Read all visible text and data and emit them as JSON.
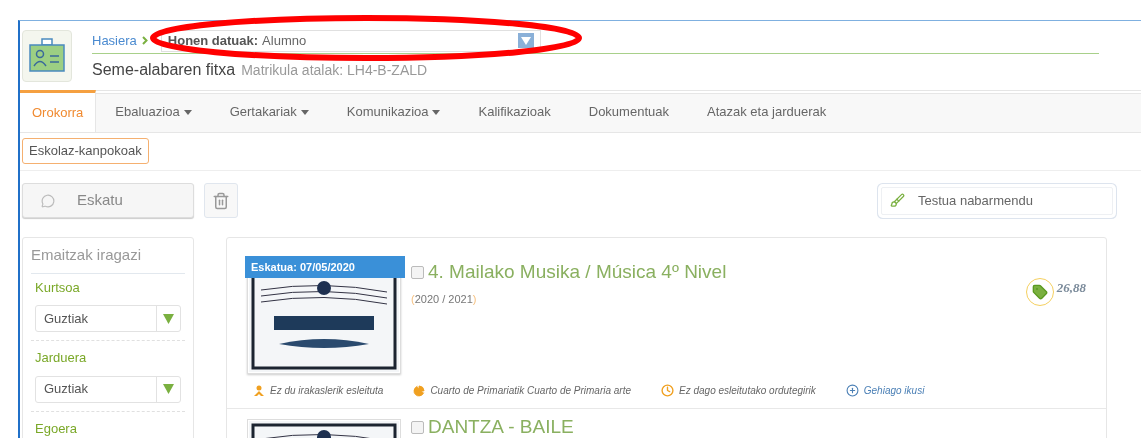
{
  "breadcrumb": {
    "home": "Hasiera",
    "selector_label": "Honen datuak:",
    "selector_value": "Alumno"
  },
  "page_title": "Seme-alabaren fitxa",
  "page_subtitle": "Matrikula atalak: LH4-B-ZALD",
  "tabs": [
    {
      "label": "Orokorra",
      "selected": true,
      "dropdown": false
    },
    {
      "label": "Ebaluazioa",
      "selected": false,
      "dropdown": true
    },
    {
      "label": "Gertakariak",
      "selected": false,
      "dropdown": true
    },
    {
      "label": "Komunikazioa",
      "selected": false,
      "dropdown": true
    },
    {
      "label": "Kalifikazioak",
      "selected": false,
      "dropdown": false
    },
    {
      "label": "Dokumentuak",
      "selected": false,
      "dropdown": false
    },
    {
      "label": "Atazak eta jarduerak",
      "selected": false,
      "dropdown": false
    }
  ],
  "subtabs": [
    {
      "label": "Eskolaz-kanpokoak",
      "selected": true
    }
  ],
  "toolbar": {
    "request_button": "Eskatu",
    "highlight_field": {
      "placeholder": "Testua nabarmendu"
    }
  },
  "filters": {
    "title": "Emaitzak iragazi",
    "groups": [
      {
        "label": "Kurtsoa",
        "value": "Guztiak"
      },
      {
        "label": "Jarduera",
        "value": "Guztiak"
      },
      {
        "label": "Egoera"
      }
    ]
  },
  "activities": [
    {
      "badge": "Eskatua: 07/05/2020",
      "title": "4. Mailako Musika / Música 4º Nivel",
      "checked": false,
      "year": {
        "open": "(",
        "text": "2020 / 2021",
        "close": ")"
      },
      "price": "26,88",
      "details": [
        {
          "kind": "teacher",
          "text": "Ez du irakaslerik esleituta"
        },
        {
          "kind": "level",
          "text": "Cuarto de Primariatik Cuarto de Primaria arte"
        },
        {
          "kind": "schedule",
          "text": "Ez dago esleitutako ordutegirik"
        },
        {
          "kind": "more",
          "text": "Gehiago ikusi"
        }
      ]
    },
    {
      "title": "DANTZA - BAILE",
      "checked": false
    }
  ]
}
